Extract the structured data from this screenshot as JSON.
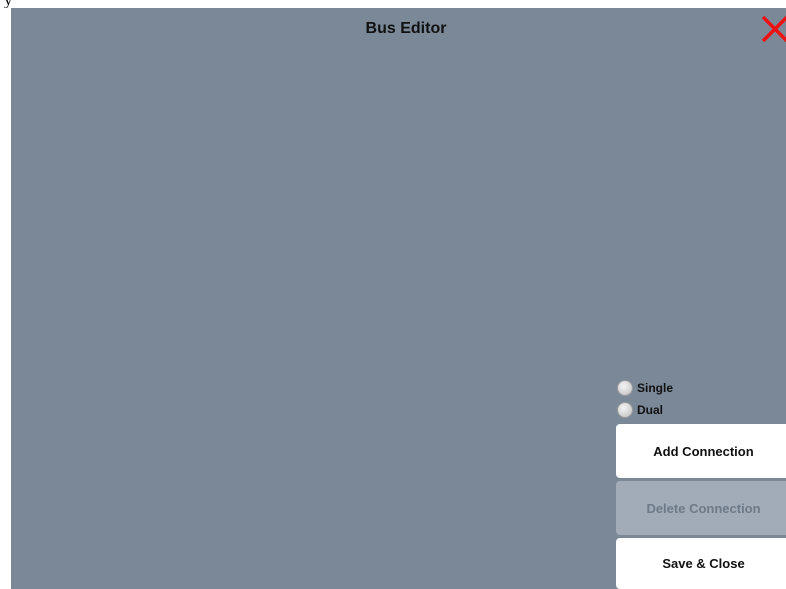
{
  "top_fragment_text": "y",
  "dialog": {
    "title": "Bus Editor",
    "background_color": "#7a8898",
    "close_icon": "close-x-icon",
    "close_icon_color": "#ee1111"
  },
  "connection_type": {
    "options": [
      {
        "label": "Single",
        "selected": false
      },
      {
        "label": "Dual",
        "selected": false
      }
    ]
  },
  "buttons": {
    "add_connection": "Add Connection",
    "delete_connection": "Delete Connection",
    "delete_connection_enabled": false,
    "save_close": "Save & Close"
  }
}
